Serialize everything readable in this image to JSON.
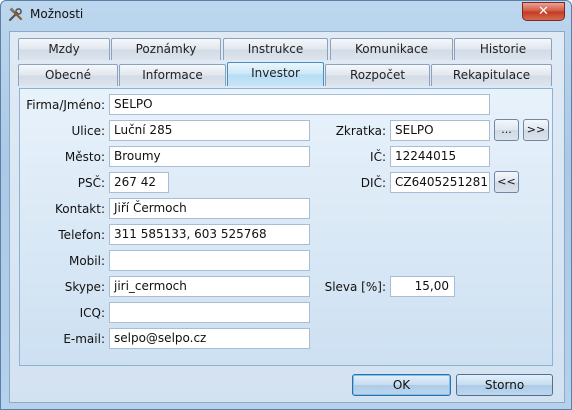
{
  "window": {
    "title": "Možnosti",
    "close_label": "✕"
  },
  "tabs_row1": [
    "Mzdy",
    "Poznámky",
    "Instrukce",
    "Komunikace",
    "Historie"
  ],
  "tabs_row2": [
    "Obecné",
    "Informace",
    "Investor",
    "Rozpočet",
    "Rekapitulace"
  ],
  "form": {
    "firma_label": "Firma/Jméno:",
    "firma_value": "SELPO",
    "ulice_label": "Ulice:",
    "ulice_value": "Luční 285",
    "mesto_label": "Město:",
    "mesto_value": "Broumy",
    "psc_label": "PSČ:",
    "psc_value": "267 42",
    "kontakt_label": "Kontakt:",
    "kontakt_value": "Jiří Čermoch",
    "telefon_label": "Telefon:",
    "telefon_value": "311 585133, 603 525768",
    "mobil_label": "Mobil:",
    "mobil_value": "",
    "skype_label": "Skype:",
    "skype_value": "jiri_cermoch",
    "icq_label": "ICQ:",
    "icq_value": "",
    "email_label": "E-mail:",
    "email_value": "selpo@selpo.cz",
    "zkratka_label": "Zkratka:",
    "zkratka_value": "SELPO",
    "ic_label": "IČ:",
    "ic_value": "12244015",
    "dic_label": "DIČ:",
    "dic_value": "CZ6405251281",
    "sleva_label": "Sleva [%]:",
    "sleva_value": "15,00",
    "browse_label": "...",
    "forward_label": ">>",
    "back_label": "<<"
  },
  "buttons": {
    "ok": "OK",
    "cancel": "Storno"
  }
}
